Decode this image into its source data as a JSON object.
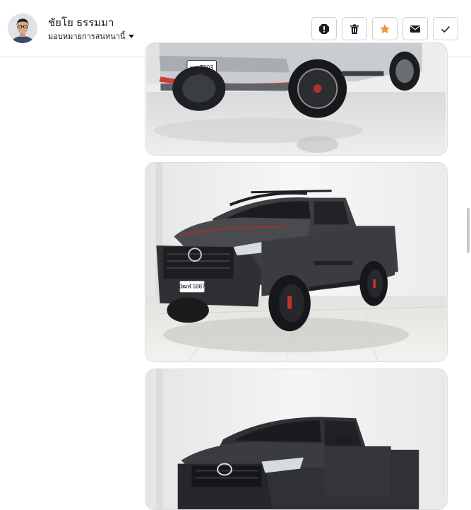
{
  "header": {
    "user_name": "ชัยโย ธรรมมา",
    "assign_label": "มอบหมายการสนทนานี้"
  },
  "actions": [
    {
      "name": "mark-spam",
      "icon": "exclamation-octagon-icon"
    },
    {
      "name": "delete",
      "icon": "trash-icon"
    },
    {
      "name": "star",
      "icon": "star-icon"
    },
    {
      "name": "mark-unread",
      "icon": "envelope-icon"
    },
    {
      "name": "mark-done",
      "icon": "check-icon"
    }
  ],
  "colors": {
    "star": "#f7923a",
    "border": "#ccd0d5"
  },
  "photos": [
    {
      "plate_text": "ษร 7303",
      "plate_sub": "ชลบุรี"
    },
    {
      "plate_text": "3ฒฬ 5987",
      "plate_sub": ""
    },
    {
      "plate_text": "",
      "plate_sub": ""
    }
  ]
}
